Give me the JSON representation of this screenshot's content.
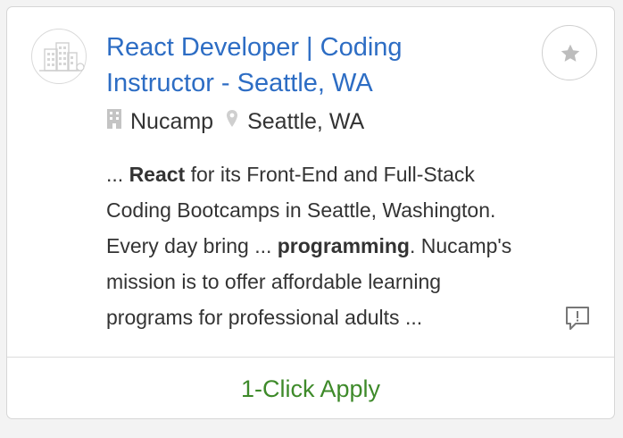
{
  "job": {
    "title_line1": "React Developer | Coding",
    "title_line2": "Instructor - Seattle, WA",
    "company": "Nucamp",
    "location": "Seattle, WA",
    "snippet": {
      "l1_pre": "... ",
      "l1_bold": "React",
      "l1_post": " for its Front-End and Full-Stack",
      "l2": "Coding Bootcamps in Seattle, Washington.",
      "l3_pre": "Every day bring ... ",
      "l3_bold": "programming",
      "l3_post": ". Nucamp's",
      "l4": "mission is to offer affordable learning",
      "l5": "programs for professional adults ..."
    },
    "apply_label": "1-Click Apply"
  },
  "icons": {
    "logo": "company-logo-building-icon",
    "favorite": "star-icon",
    "company": "building-icon",
    "location": "map-pin-icon",
    "report": "report-flag-icon"
  },
  "colors": {
    "title": "#2d6dc4",
    "apply": "#3e8a2a",
    "text": "#333333",
    "icon_gray": "#bdbdbd"
  }
}
